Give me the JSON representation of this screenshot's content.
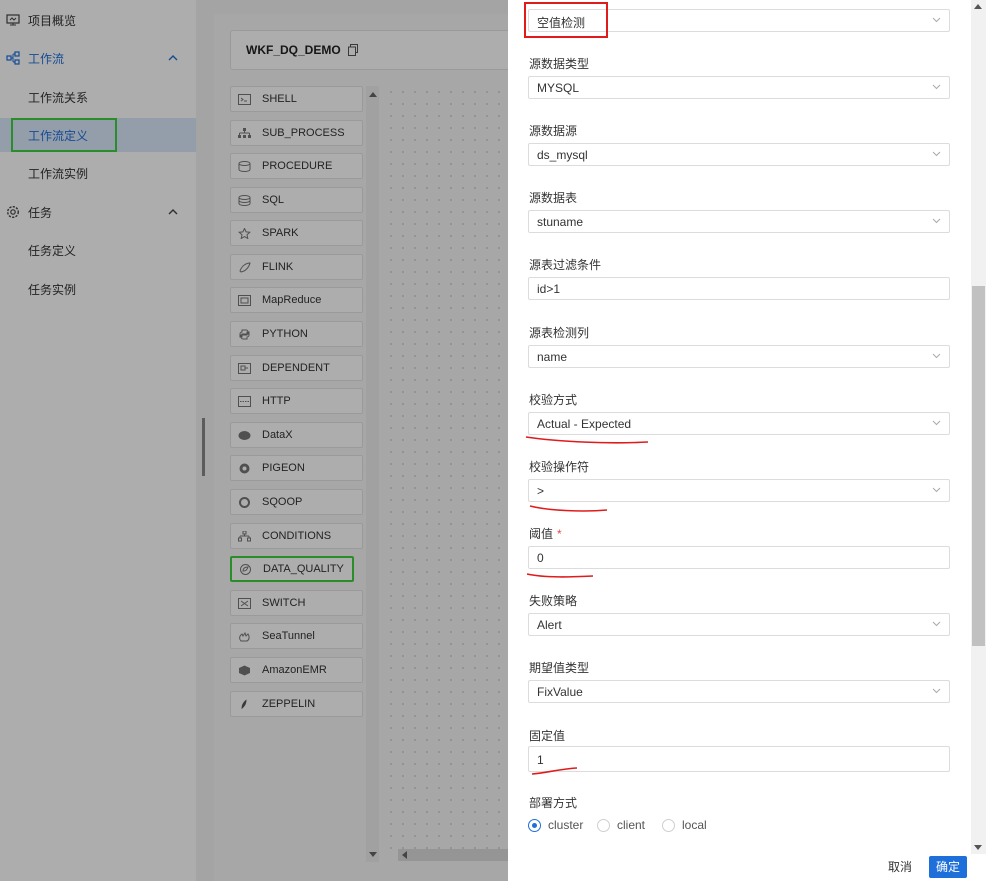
{
  "sidebar": {
    "project_overview": "项目概览",
    "workflow": "工作流",
    "workflow_relation": "工作流关系",
    "workflow_definition": "工作流定义",
    "workflow_instance": "工作流实例",
    "task": "任务",
    "task_definition": "任务定义",
    "task_instance": "任务实例"
  },
  "workflow": {
    "title": "WKF_DQ_DEMO"
  },
  "task_types": [
    {
      "label": "SHELL",
      "icon": "shell-icon"
    },
    {
      "label": "SUB_PROCESS",
      "icon": "sub-process-icon"
    },
    {
      "label": "PROCEDURE",
      "icon": "procedure-icon"
    },
    {
      "label": "SQL",
      "icon": "sql-icon"
    },
    {
      "label": "SPARK",
      "icon": "spark-icon"
    },
    {
      "label": "FLINK",
      "icon": "flink-icon"
    },
    {
      "label": "MapReduce",
      "icon": "mapreduce-icon"
    },
    {
      "label": "PYTHON",
      "icon": "python-icon"
    },
    {
      "label": "DEPENDENT",
      "icon": "dependent-icon"
    },
    {
      "label": "HTTP",
      "icon": "http-icon"
    },
    {
      "label": "DataX",
      "icon": "datax-icon"
    },
    {
      "label": "PIGEON",
      "icon": "pigeon-icon"
    },
    {
      "label": "SQOOP",
      "icon": "sqoop-icon"
    },
    {
      "label": "CONDITIONS",
      "icon": "conditions-icon"
    },
    {
      "label": "DATA_QUALITY",
      "icon": "data-quality-icon"
    },
    {
      "label": "SWITCH",
      "icon": "switch-icon"
    },
    {
      "label": "SeaTunnel",
      "icon": "seatunnel-icon"
    },
    {
      "label": "AmazonEMR",
      "icon": "amazon-emr-icon"
    },
    {
      "label": "ZEPPELIN",
      "icon": "zeppelin-icon"
    }
  ],
  "form": {
    "rule_type": {
      "value": "空值检测"
    },
    "src_connector_type": {
      "label": "源数据类型",
      "value": "MYSQL"
    },
    "src_datasource": {
      "label": "源数据源",
      "value": "ds_mysql"
    },
    "src_table": {
      "label": "源数据表",
      "value": "stuname"
    },
    "src_filter": {
      "label": "源表过滤条件",
      "value": "id>1"
    },
    "src_field": {
      "label": "源表检测列",
      "value": "name"
    },
    "check_type": {
      "label": "校验方式",
      "value": "Actual - Expected"
    },
    "operator": {
      "label": "校验操作符",
      "value": ">"
    },
    "threshold": {
      "label": "阈值",
      "required_mark": "*",
      "value": "0"
    },
    "failure_strategy": {
      "label": "失败策略",
      "value": "Alert"
    },
    "expected_type": {
      "label": "期望值类型",
      "value": "FixValue"
    },
    "fix_value": {
      "label": "固定值",
      "value": "1"
    },
    "deploy_mode": {
      "label": "部署方式",
      "options": [
        "cluster",
        "client",
        "local"
      ],
      "selected": "cluster"
    }
  },
  "buttons": {
    "cancel": "取消",
    "confirm": "确定"
  },
  "colors": {
    "primary": "#1e6fd9",
    "highlight_green": "#3dd13d",
    "annotation_red": "#e01b1b"
  }
}
